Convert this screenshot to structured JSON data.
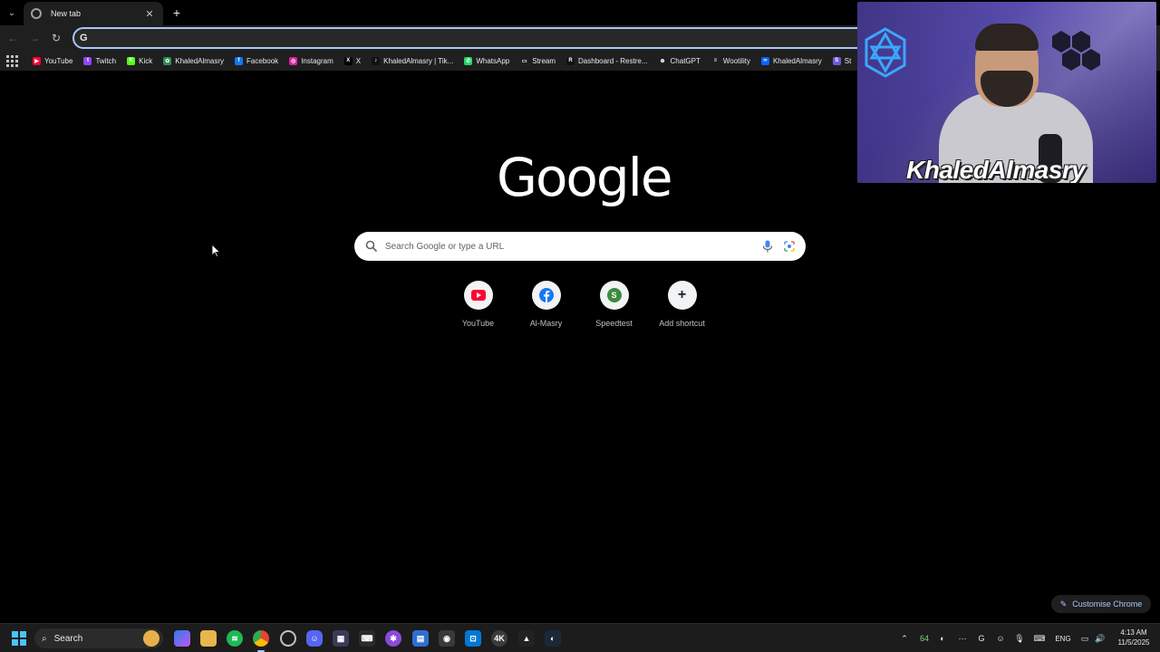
{
  "tabs": [
    {
      "title": "New tab"
    }
  ],
  "omnibox": {
    "value": "",
    "placeholder": ""
  },
  "bookmarks": [
    {
      "label": "YouTube",
      "color": "#ff0033",
      "glyph": "▶"
    },
    {
      "label": "Twitch",
      "color": "#9146ff",
      "glyph": "t"
    },
    {
      "label": "Kick",
      "color": "#53fc18",
      "glyph": "K"
    },
    {
      "label": "KhaledAlmasry",
      "color": "#2e8b57",
      "glyph": "✿"
    },
    {
      "label": "Facebook",
      "color": "#1877f2",
      "glyph": "f"
    },
    {
      "label": "Instagram",
      "color": "#d6249f",
      "glyph": "◎"
    },
    {
      "label": "X",
      "color": "#000000",
      "glyph": "X"
    },
    {
      "label": "KhaledAlmasry | Tik...",
      "color": "#111111",
      "glyph": "♪"
    },
    {
      "label": "WhatsApp",
      "color": "#25d366",
      "glyph": "✆"
    },
    {
      "label": "Stream",
      "color": "transparent",
      "glyph": "▭"
    },
    {
      "label": "Dashboard - Restre...",
      "color": "#111111",
      "glyph": "R"
    },
    {
      "label": "ChatGPT",
      "color": "transparent",
      "glyph": "⊛"
    },
    {
      "label": "Wootility",
      "color": "transparent",
      "glyph": "≡"
    },
    {
      "label": "KhaledAlmasry",
      "color": "#0866ff",
      "glyph": "∞"
    },
    {
      "label": "St",
      "color": "#6b5bd6",
      "glyph": "S"
    }
  ],
  "logo": {
    "text": "Google"
  },
  "search": {
    "placeholder": "Search Google or type a URL"
  },
  "shortcuts": [
    {
      "label": "YouTube",
      "icon": "youtube-icon"
    },
    {
      "label": "Al-Masry",
      "icon": "facebook-icon"
    },
    {
      "label": "Speedtest",
      "icon": "speedtest-icon",
      "letter": "S"
    },
    {
      "label": "Add shortcut",
      "icon": "plus-icon"
    }
  ],
  "customise": {
    "label": "Customise Chrome"
  },
  "webcam": {
    "name": "KhaledAlmasry"
  },
  "taskbar": {
    "search_label": "Search",
    "badge_count": "64",
    "language": "ENG",
    "time": "4:13 AM",
    "date": "11/5/2025"
  }
}
